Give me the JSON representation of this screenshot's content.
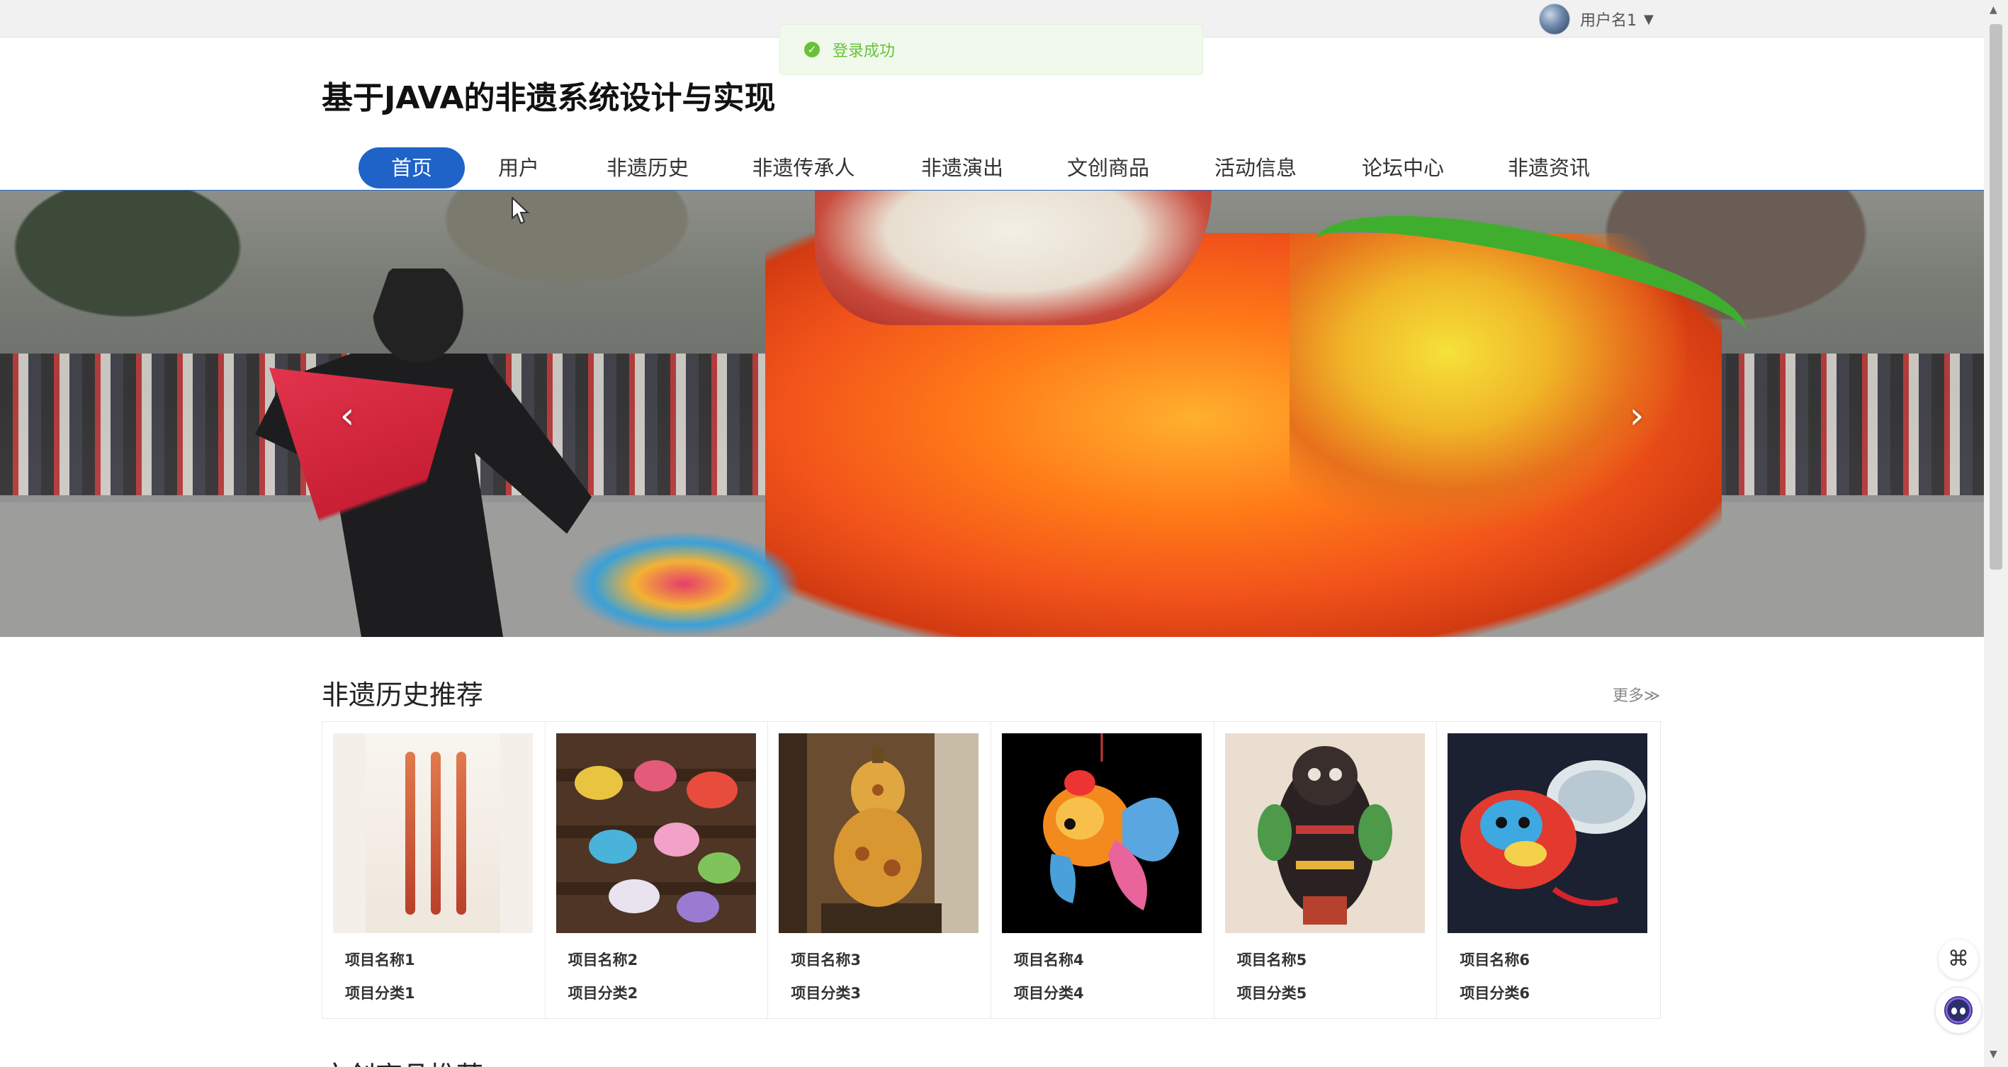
{
  "header": {
    "user_name": "用户名1",
    "caret": "▼"
  },
  "toast": {
    "icon": "✓",
    "message": "登录成功"
  },
  "site": {
    "title": "基于JAVA的非遗系统设计与实现"
  },
  "nav": {
    "items": [
      {
        "label": "首页",
        "active": true
      },
      {
        "label": "用户"
      },
      {
        "label": "非遗历史"
      },
      {
        "label": "非遗传承人"
      },
      {
        "label": "非遗演出"
      },
      {
        "label": "文创商品"
      },
      {
        "label": "活动信息"
      },
      {
        "label": "论坛中心"
      },
      {
        "label": "非遗资讯"
      }
    ]
  },
  "carousel": {
    "prev": "‹",
    "next": "›"
  },
  "history_section": {
    "title": "非遗历史推荐",
    "more": "更多≫",
    "cards": [
      {
        "name": "项目名称1",
        "category": "项目分类1"
      },
      {
        "name": "项目名称2",
        "category": "项目分类2"
      },
      {
        "name": "项目名称3",
        "category": "项目分类3"
      },
      {
        "name": "项目名称4",
        "category": "项目分类4"
      },
      {
        "name": "项目名称5",
        "category": "项目分类5"
      },
      {
        "name": "项目名称6",
        "category": "项目分类6"
      }
    ]
  },
  "next_section": {
    "title": "文创商品推荐"
  },
  "colors": {
    "accent": "#1f63c8",
    "success": "#67c23a",
    "success_bg": "#f0f9eb"
  }
}
